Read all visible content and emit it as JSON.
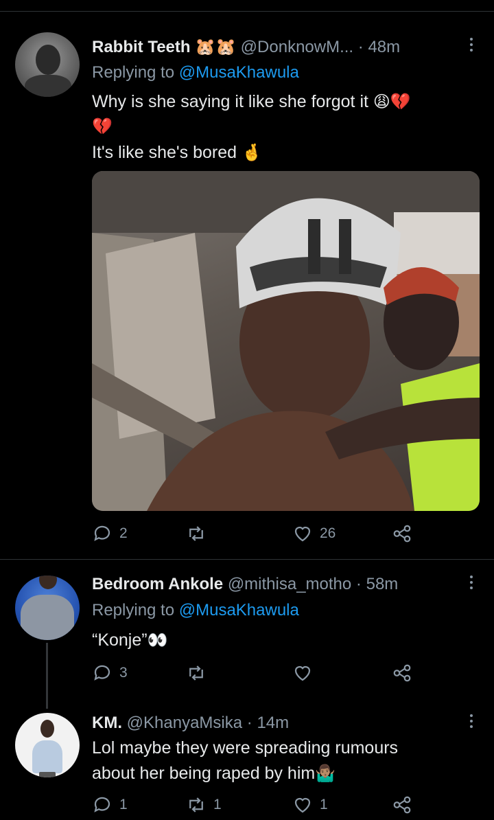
{
  "tweets": [
    {
      "name": "Rabbit Teeth",
      "name_emoji": "🐹🐹",
      "handle": "@DonknowM...",
      "dot": "·",
      "time": "48m",
      "replying_prefix": "Replying to",
      "replying_handle": "@MusaKhawula",
      "line1": "Why is she saying it like she forgot it",
      "line1_emoji": "😩💔",
      "line2_emoji": "💔",
      "line3": "It's like she's bored",
      "line3_emoji": "🤞",
      "replies": "2",
      "retweets": "",
      "likes": "26"
    },
    {
      "name": "Bedroom Ankole",
      "handle": "@mithisa_motho",
      "dot": "·",
      "time": "58m",
      "replying_prefix": "Replying to",
      "replying_handle": "@MusaKhawula",
      "line1": "“Konje”",
      "line1_emoji": "👀",
      "replies": "3",
      "retweets": "",
      "likes": ""
    },
    {
      "name": "KM.",
      "handle": "@KhanyaMsika",
      "dot": "·",
      "time": "14m",
      "line1": "Lol maybe they were spreading rumours",
      "line2": "about her being raped by him",
      "line2_emoji": "🤷🏽‍♂️",
      "replies": "1",
      "retweets": "1",
      "likes": "1"
    }
  ],
  "icons": [
    "reply-icon",
    "retweet-icon",
    "like-icon",
    "share-icon",
    "more-icon"
  ],
  "colors": {
    "background": "#000000",
    "text": "#e7e9ea",
    "muted": "#8b98a5",
    "link": "#1d9bf0",
    "divider": "#2f3336"
  }
}
